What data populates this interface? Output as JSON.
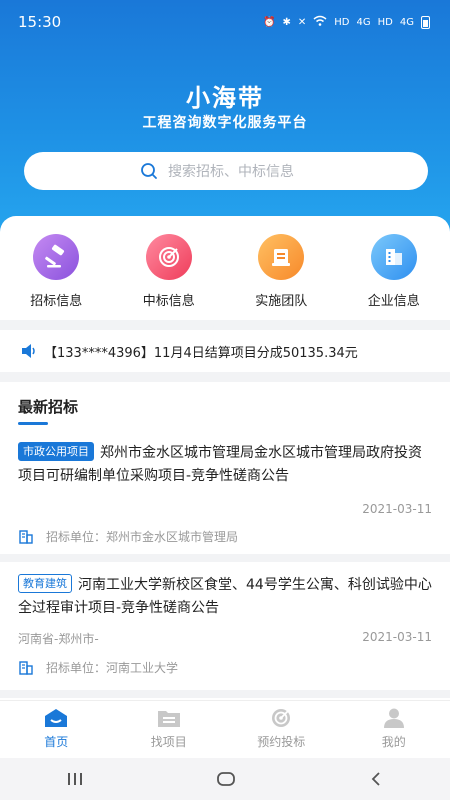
{
  "status": {
    "time": "15:30",
    "hd1": "HD",
    "hd2": "HD",
    "net1": "4G",
    "net2": "4G"
  },
  "app": {
    "title": "小海带",
    "subtitle": "工程咨询数字化服务平台"
  },
  "search": {
    "placeholder": "搜索招标、中标信息"
  },
  "categories": [
    {
      "label": "招标信息",
      "icon": "gavel-icon"
    },
    {
      "label": "中标信息",
      "icon": "target-icon"
    },
    {
      "label": "实施团队",
      "icon": "team-icon"
    },
    {
      "label": "企业信息",
      "icon": "building-icon"
    }
  ],
  "notice": {
    "text": "【133****4396】11月4日结算项目分成50135.34元",
    "icon": "speaker-icon"
  },
  "list": {
    "title": "最新招标",
    "items": [
      {
        "tag": "市政公用项目",
        "title": "郑州市金水区城市管理局金水区城市管理局政府投资项目可研编制单位采购项目-竞争性磋商公告",
        "region": "",
        "date": "2021-03-11",
        "unit_label": "招标单位：",
        "unit": "郑州市金水区城市管理局"
      },
      {
        "tag": "教育建筑",
        "title": "河南工业大学新校区食堂、44号学生公寓、科创试验中心全过程审计项目-竞争性磋商公告",
        "region": "河南省-郑州市-",
        "date": "2021-03-11",
        "unit_label": "招标单位：",
        "unit": "河南工业大学"
      }
    ]
  },
  "tabs": [
    {
      "label": "首页",
      "icon": "home-icon",
      "active": true
    },
    {
      "label": "找项目",
      "icon": "folder-icon",
      "active": false
    },
    {
      "label": "预约投标",
      "icon": "target-icon",
      "active": false
    },
    {
      "label": "我的",
      "icon": "user-icon",
      "active": false
    }
  ],
  "colors": {
    "primary": "#1a78d8",
    "header_light": "#27a9f0"
  }
}
